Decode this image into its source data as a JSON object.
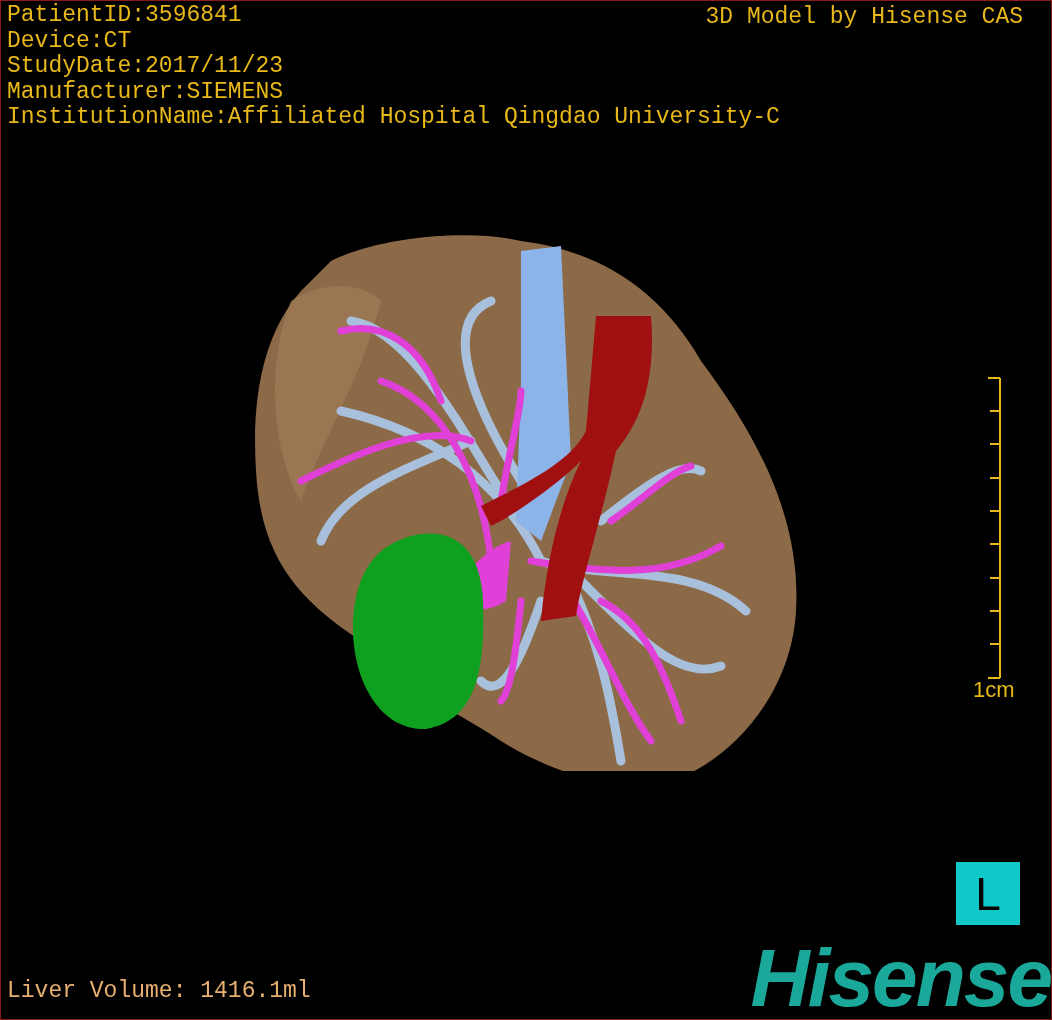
{
  "patient_info": [
    "PatientID:3596841",
    "Device:CT",
    "StudyDate:2017/11/23",
    "Manufacturer:SIEMENS",
    "InstitutionName:Affiliated Hospital Qingdao University-C"
  ],
  "model_credit": "3D Model by Hisense CAS",
  "scale_bar": {
    "label": "1cm"
  },
  "orientation_marker": "L",
  "measurement": "Liver Volume: 1416.1ml",
  "logo": "Hisense"
}
